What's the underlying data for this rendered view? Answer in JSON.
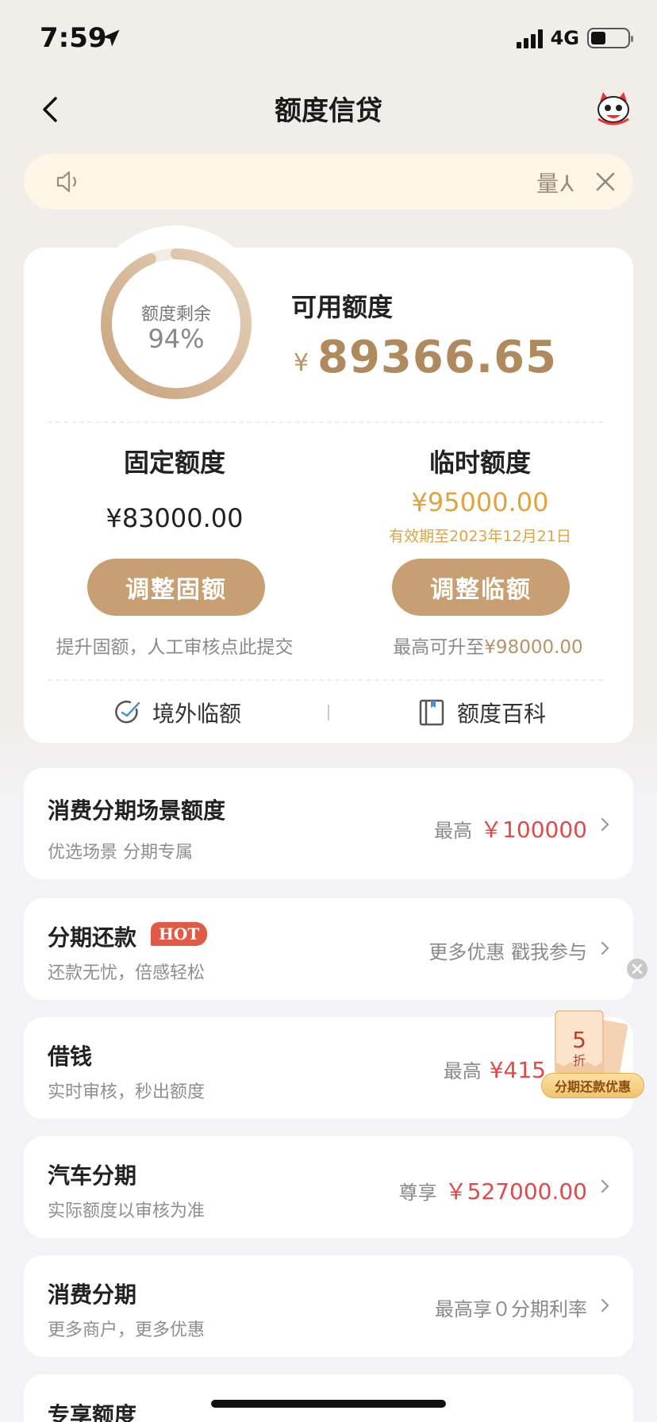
{
  "status_bar": {
    "time": "7:59",
    "network": "4G"
  },
  "nav": {
    "title": "额度信贷"
  },
  "notice": {
    "text": "量⅄"
  },
  "credit": {
    "ring_label": "额度剩余",
    "ring_percent": "94%",
    "ring_fraction": 0.94,
    "available_label": "可用额度",
    "available_currency": "¥",
    "available_amount": "89366.65",
    "fixed": {
      "title": "固定额度",
      "amount": "¥83000.00",
      "button": "调整固额",
      "hint": "提升固额，人工审核点此提交"
    },
    "temporary": {
      "title": "临时额度",
      "amount": "¥95000.00",
      "valid_until": "有效期至2023年12月21日",
      "button": "调整临额",
      "hint_prefix": "最高可升至",
      "hint_amount": "¥98000.00"
    },
    "links": {
      "overseas": "境外临额",
      "wiki": "额度百科"
    }
  },
  "items": [
    {
      "title": "消费分期场景额度",
      "sub": "优选场景 分期专属",
      "right_prefix": "最高",
      "right_value": "￥100000"
    },
    {
      "title": "分期还款",
      "badge": "HOT",
      "sub": "还款无忧，倍感轻松",
      "right_prefix": "更多优惠 戳我参与",
      "right_value": ""
    },
    {
      "title": "借钱",
      "sub": "实时审核，秒出额度",
      "right_prefix": "最高",
      "right_value": "¥415"
    },
    {
      "title": "汽车分期",
      "sub": "实际额度以审核为准",
      "right_prefix": "尊享",
      "right_value": "￥527000.00"
    },
    {
      "title": "消费分期",
      "sub": "更多商户，更多优惠",
      "right_prefix": "最高享０分期利率",
      "right_value": ""
    },
    {
      "title": "专享额度"
    }
  ],
  "promo": {
    "label": "分期还款优惠",
    "discount": "5",
    "discount_unit": "折"
  },
  "colors": {
    "gold": "#c89f72",
    "amount_gold": "#b08a5f",
    "orange": "#e1a33d",
    "red": "#e24a4a"
  }
}
